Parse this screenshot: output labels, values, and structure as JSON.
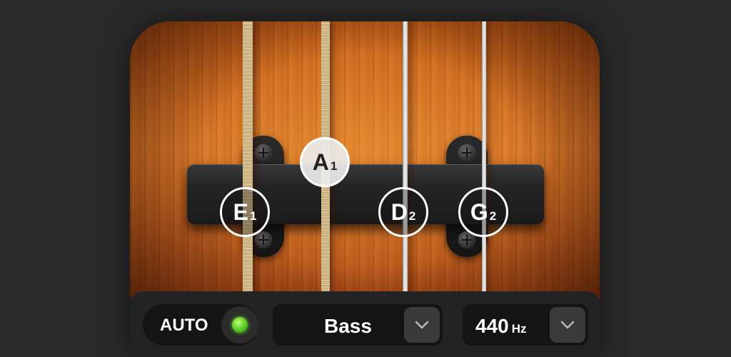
{
  "strings": {
    "E": {
      "letter": "E",
      "octave": "1"
    },
    "A": {
      "letter": "A",
      "octave": "1",
      "selected": true
    },
    "D": {
      "letter": "D",
      "octave": "2"
    },
    "G": {
      "letter": "G",
      "octave": "2"
    }
  },
  "controls": {
    "auto_label": "AUTO",
    "auto_enabled": true,
    "instrument": "Bass",
    "reference_value": "440",
    "reference_unit": "Hz"
  },
  "icons": {
    "chevron": "chevron-down-icon",
    "led": "status-led-icon"
  },
  "colors": {
    "led": "#4ec31a",
    "wood": "#d8782a",
    "background": "#2a2a2a"
  }
}
